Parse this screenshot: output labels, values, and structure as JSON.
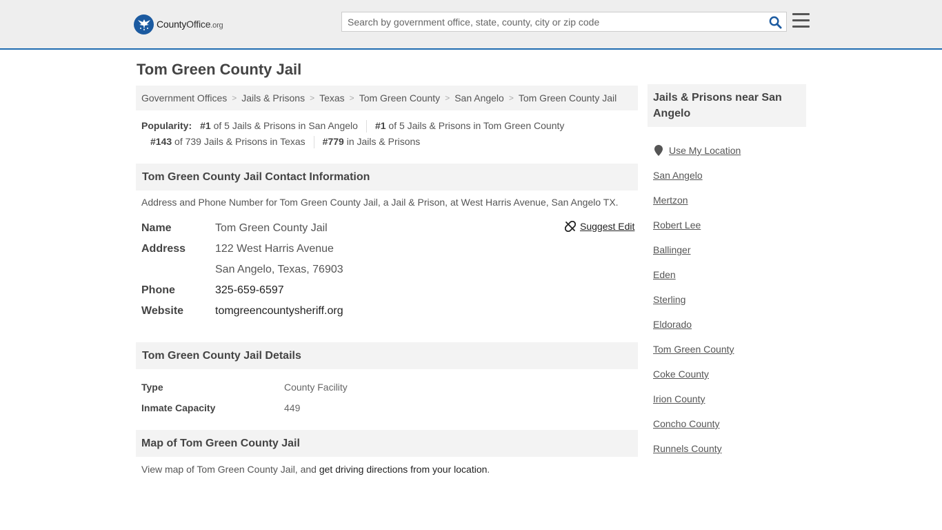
{
  "header": {
    "logo_county": "County",
    "logo_office": "Office",
    "logo_org": ".org",
    "search_placeholder": "Search by government office, state, county, city or zip code",
    "search_icon": "search-icon",
    "menu_icon": "hamburger-menu-icon"
  },
  "page": {
    "title": "Tom Green County Jail"
  },
  "breadcrumb": [
    "Government Offices",
    "Jails & Prisons",
    "Texas",
    "Tom Green County",
    "San Angelo",
    "Tom Green County Jail"
  ],
  "popularity": {
    "label": "Popularity:",
    "items": [
      {
        "rank": "#1",
        "text": "of 5 Jails & Prisons in San Angelo"
      },
      {
        "rank": "#1",
        "text": "of 5 Jails & Prisons in Tom Green County"
      },
      {
        "rank": "#143",
        "text": "of 739 Jails & Prisons in Texas"
      },
      {
        "rank": "#779",
        "text": "in Jails & Prisons"
      }
    ]
  },
  "contact": {
    "heading": "Tom Green County Jail Contact Information",
    "description": "Address and Phone Number for Tom Green County Jail, a Jail & Prison, at West Harris Avenue, San Angelo TX.",
    "suggest_edit": "Suggest Edit",
    "name_label": "Name",
    "name": "Tom Green County Jail",
    "address_label": "Address",
    "address_line1": "122 West Harris Avenue",
    "address_line2": "San Angelo, Texas, 76903",
    "phone_label": "Phone",
    "phone": "325-659-6597",
    "website_label": "Website",
    "website": "tomgreencountysheriff.org"
  },
  "details": {
    "heading": "Tom Green County Jail Details",
    "rows": [
      {
        "key": "Type",
        "value": "County Facility"
      },
      {
        "key": "Inmate Capacity",
        "value": "449"
      }
    ]
  },
  "map": {
    "heading": "Map of Tom Green County Jail",
    "text": "View map of Tom Green County Jail, and ",
    "link": "get driving directions from your location",
    "period": "."
  },
  "sidebar": {
    "heading": "Jails & Prisons near San Angelo",
    "use_location": "Use My Location",
    "links": [
      "San Angelo",
      "Mertzon",
      "Robert Lee",
      "Ballinger",
      "Eden",
      "Sterling",
      "Eldorado",
      "Tom Green County",
      "Coke County",
      "Irion County",
      "Concho County",
      "Runnels County"
    ]
  },
  "colors": {
    "accent": "#1f6cb0",
    "topbar": "#eeeeee",
    "panel": "#f3f3f3"
  }
}
